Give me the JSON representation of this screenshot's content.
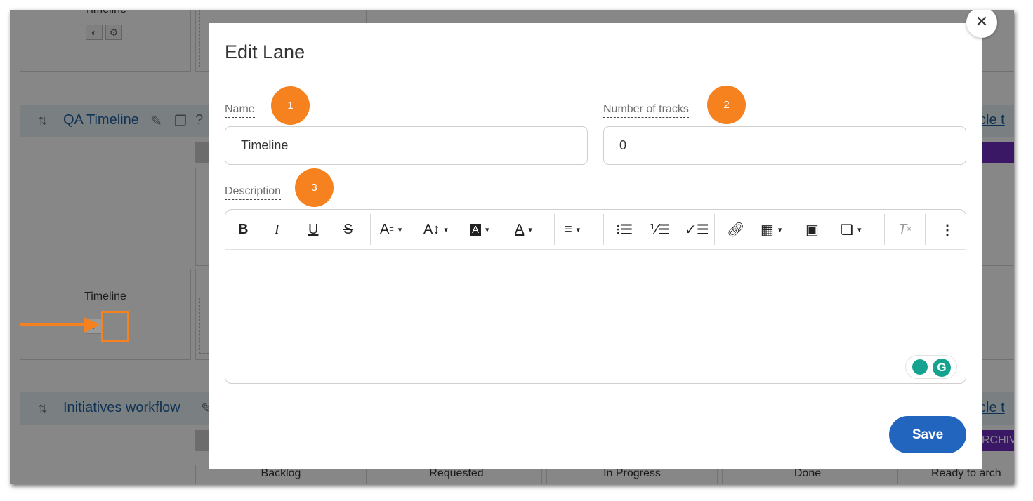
{
  "background": {
    "top_lane_label": "Timeline",
    "lane_qa": {
      "title": "QA Timeline",
      "right_link": "ycle t"
    },
    "lane_card": {
      "label": "Timeline"
    },
    "lane_initiatives": {
      "title": "Initiatives workflow",
      "right_link": "ycle t",
      "archive_label": "RCHIV"
    },
    "columns": [
      "Backlog",
      "Requested",
      "In Progress",
      "Done",
      "Ready to arch"
    ]
  },
  "modal": {
    "title": "Edit Lane",
    "name_label": "Name",
    "name_value": "Timeline",
    "tracks_label": "Number of tracks",
    "tracks_value": "0",
    "description_label": "Description",
    "save_label": "Save",
    "close_symbol": "✕"
  },
  "callouts": [
    "1",
    "2",
    "3"
  ],
  "toolbar_icons": [
    "bold-icon",
    "italic-icon",
    "underline-icon",
    "strikethrough-icon",
    "font-family-icon",
    "font-size-icon",
    "highlight-color-icon",
    "text-color-icon",
    "align-icon",
    "bulleted-list-icon",
    "numbered-list-icon",
    "checklist-icon",
    "link-icon",
    "table-icon",
    "image-icon",
    "source-code-icon",
    "clear-format-icon",
    "more-icon"
  ],
  "colors": {
    "accent": "#f5821f",
    "primary": "#2265bf",
    "lane_title": "#1f5f9f",
    "grammarly": "#15a38f"
  }
}
